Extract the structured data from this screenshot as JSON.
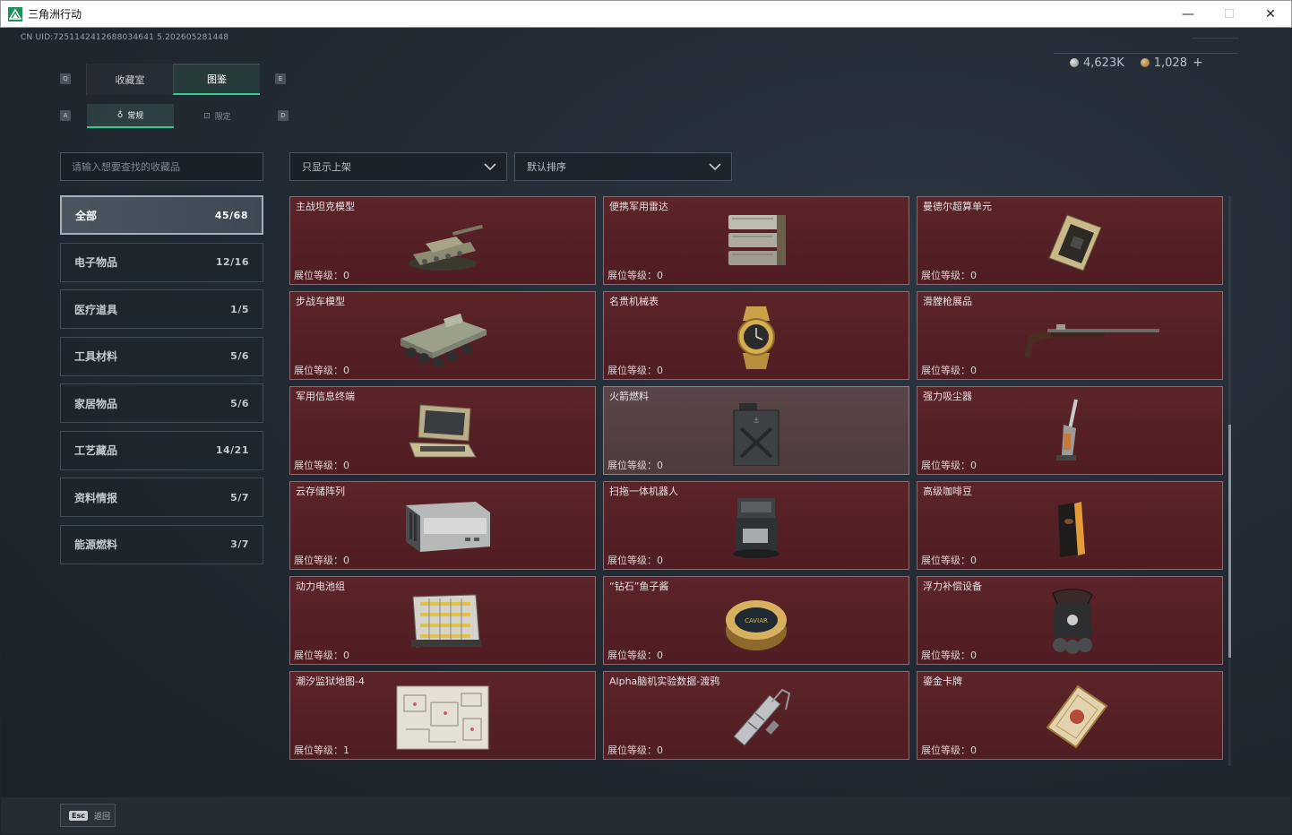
{
  "window": {
    "title": "三角洲行动",
    "minimize": "—",
    "maximize": "☐",
    "close": "✕"
  },
  "uid": "CN UID:7251142412688034641 5.202605281448",
  "currency": {
    "silver": "4,623K",
    "gold": "1,028",
    "plus": "+"
  },
  "keyhints": {
    "q": "Q",
    "e": "E",
    "a": "A",
    "d": "D"
  },
  "main_tabs": [
    {
      "label": "收藏室"
    },
    {
      "label": "图鉴"
    }
  ],
  "sub_tabs": [
    {
      "label": "常规",
      "icon": "🜁"
    },
    {
      "label": "限定",
      "icon": "⊡"
    }
  ],
  "search": {
    "placeholder": "请输入想要查找的收藏品"
  },
  "filters": {
    "shelf": "只显示上架",
    "sort": "默认排序"
  },
  "categories": [
    {
      "label": "全部",
      "count": "45/68"
    },
    {
      "label": "电子物品",
      "count": "12/16"
    },
    {
      "label": "医疗道具",
      "count": "1/5"
    },
    {
      "label": "工具材料",
      "count": "5/6"
    },
    {
      "label": "家居物品",
      "count": "5/6"
    },
    {
      "label": "工艺藏品",
      "count": "14/21"
    },
    {
      "label": "资料情报",
      "count": "5/7"
    },
    {
      "label": "能源燃料",
      "count": "3/7"
    }
  ],
  "items": [
    {
      "name": "主战坦克模型",
      "level": "展位等级：0",
      "icon": "tank"
    },
    {
      "name": "便携军用雷达",
      "level": "展位等级：0",
      "icon": "radar"
    },
    {
      "name": "曼德尔超算单元",
      "level": "展位等级：0",
      "icon": "chip"
    },
    {
      "name": "步战车模型",
      "level": "展位等级：0",
      "icon": "ifv"
    },
    {
      "name": "名贵机械表",
      "level": "展位等级：0",
      "icon": "watch"
    },
    {
      "name": "滑膛枪展品",
      "level": "展位等级：0",
      "icon": "musket"
    },
    {
      "name": "军用信息终端",
      "level": "展位等级：0",
      "icon": "terminal"
    },
    {
      "name": "火箭燃料",
      "level": "展位等级：0",
      "icon": "jerrycan"
    },
    {
      "name": "强力吸尘器",
      "level": "展位等级：0",
      "icon": "vacuum"
    },
    {
      "name": "云存储阵列",
      "level": "展位等级：0",
      "icon": "storage"
    },
    {
      "name": "扫拖一体机器人",
      "level": "展位等级：0",
      "icon": "robot"
    },
    {
      "name": "高级咖啡豆",
      "level": "展位等级：0",
      "icon": "coffee"
    },
    {
      "name": "动力电池组",
      "level": "展位等级：0",
      "icon": "battery"
    },
    {
      "name": "“钻石”鱼子酱",
      "level": "展位等级：0",
      "icon": "caviar"
    },
    {
      "name": "浮力补偿设备",
      "level": "展位等级：0",
      "icon": "bcd"
    },
    {
      "name": "潮汐监狱地图-4",
      "level": "展位等级：1",
      "icon": "map"
    },
    {
      "name": "Alpha脑机实验数据-渡鸦",
      "level": "展位等级：0",
      "icon": "datadrive"
    },
    {
      "name": "鎏金卡牌",
      "level": "展位等级：0",
      "icon": "card"
    }
  ],
  "footer": {
    "esc_key": "Esc",
    "esc_label": "返回"
  }
}
